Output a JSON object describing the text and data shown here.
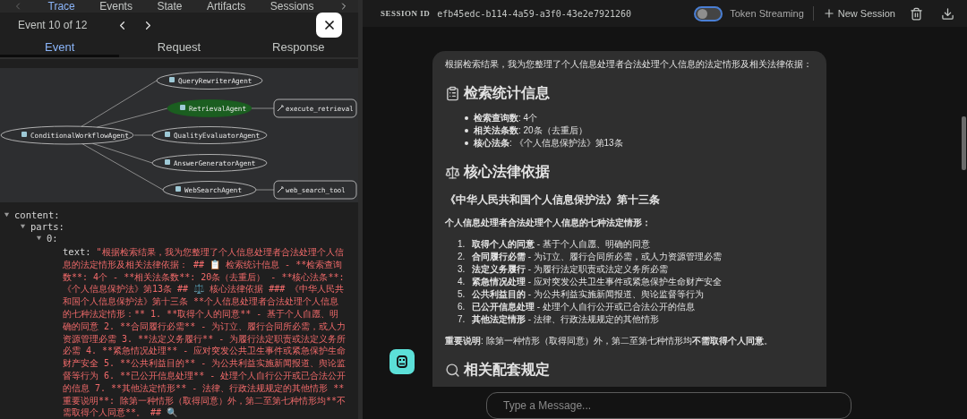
{
  "top_tabs": [
    {
      "label": "Trace",
      "selected": true
    },
    {
      "label": "Events",
      "selected": false
    },
    {
      "label": "State",
      "selected": false
    },
    {
      "label": "Artifacts",
      "selected": false
    },
    {
      "label": "Sessions",
      "selected": false
    }
  ],
  "event_nav": {
    "label": "Event 10 of 12"
  },
  "detail_tabs": [
    {
      "label": "Event",
      "selected": true
    },
    {
      "label": "Request",
      "selected": false
    },
    {
      "label": "Response",
      "selected": false
    }
  ],
  "graph": {
    "root": "ConditionalWorkflowAgent",
    "agents": [
      {
        "name": "QueryRewriterAgent",
        "selected": false
      },
      {
        "name": "RetrievalAgent",
        "selected": true,
        "tool": "execute_retrieval"
      },
      {
        "name": "QualityEvaluatorAgent",
        "selected": false
      },
      {
        "name": "AnswerGeneratorAgent",
        "selected": false
      },
      {
        "name": "WebSearchAgent",
        "selected": false,
        "tool": "web_search_tool"
      }
    ]
  },
  "tree": [
    {
      "key": "content:",
      "expanded": true,
      "children": [
        {
          "key": "parts:",
          "expanded": true,
          "children": [
            {
              "key": "0:",
              "expanded": true,
              "fields": [
                {
                  "key": "text:",
                  "value": "\"根据检索结果，我为您整理了个人信息处理者合法处理个人信息的法定情形及相关法律依据： ## 📋 检索统计信息 - **检索查询数**: 4个 - **相关法条数**: 20条（去重后） - **核心法条**: 《个人信息保护法》第13条 ## ⚖️ 核心法律依据 ### 《中华人民共和国个人信息保护法》第十三条 **个人信息处理者合法处理个人信息的七种法定情形：** 1. **取得个人的同意** - 基于个人自愿、明确的同意 2. **合同履行必需** - 为订立、履行合同所必需，或人力资源管理必需 3. **法定义务履行** - 为履行法定职责或法定义务所必需 4. **紧急情况处理** - 应对突发公共卫生事件或紧急保护生命财产安全 5. **公共利益目的** - 为公共利益实施新闻报道、舆论监督等行为 6. **已公开信息处理** - 处理个人自行公开或已合法公开的信息 7. **其他法定情形** - 法律、行政法规规定的其他情形 **重要说明**: 除第一种情形（取得同意）外，第二至第七种情形均**不需取得个人同意**。 ## 🔍"
                }
              ]
            }
          ]
        }
      ]
    }
  ],
  "session": {
    "label": "SESSION ID",
    "id": "efb45edc-b114-4a59-a3f0-43e2e7921260"
  },
  "token_streaming": {
    "label": "Token Streaming",
    "on": false
  },
  "new_session": {
    "label": "New Session"
  },
  "message": {
    "intro": "根据检索结果，我为您整理了个人信息处理者合法处理个人信息的法定情形及相关法律依据：",
    "sections": [
      {
        "title": "检索统计信息",
        "blocks": [
          {
            "kind": "bullets",
            "items": [
              "**检索查询数**: 4个",
              "**相关法条数**: 20条（去重后）",
              "**核心法条**: 《个人信息保护法》第13条"
            ]
          }
        ]
      },
      {
        "title": "核心法律依据",
        "blocks": [
          {
            "kind": "subheading",
            "text": "《中华人民共和国个人信息保护法》第十三条"
          },
          {
            "kind": "lead",
            "text": "个人信息处理者合法处理个人信息的七种法定情形："
          },
          {
            "kind": "numbered",
            "items": [
              {
                "number": "1.",
                "text": "**取得个人的同意** - 基于个人自愿、明确的同意"
              },
              {
                "number": "2.",
                "text": "**合同履行必需** - 为订立、履行合同所必需，或人力资源管理必需"
              },
              {
                "number": "3.",
                "text": "**法定义务履行** - 为履行法定职责或法定义务所必需"
              },
              {
                "number": "4.",
                "text": "**紧急情况处理** - 应对突发公共卫生事件或紧急保护生命财产安全"
              },
              {
                "number": "5.",
                "text": "**公共利益目的** - 为公共利益实施新闻报道、舆论监督等行为"
              },
              {
                "number": "6.",
                "text": "**已公开信息处理** - 处理个人自行公开或已合法公开的信息"
              },
              {
                "number": "7.",
                "text": "**其他法定情形** - 法律、行政法规规定的其他情形"
              }
            ]
          },
          {
            "kind": "paragraph",
            "text": "**重要说明**: 除第一种情形（取得同意）外，第二至第七种情形均**不需取得个人同意**。"
          }
        ]
      },
      {
        "title": "相关配套规定"
      }
    ]
  },
  "composer": {
    "placeholder": "Type a Message..."
  }
}
